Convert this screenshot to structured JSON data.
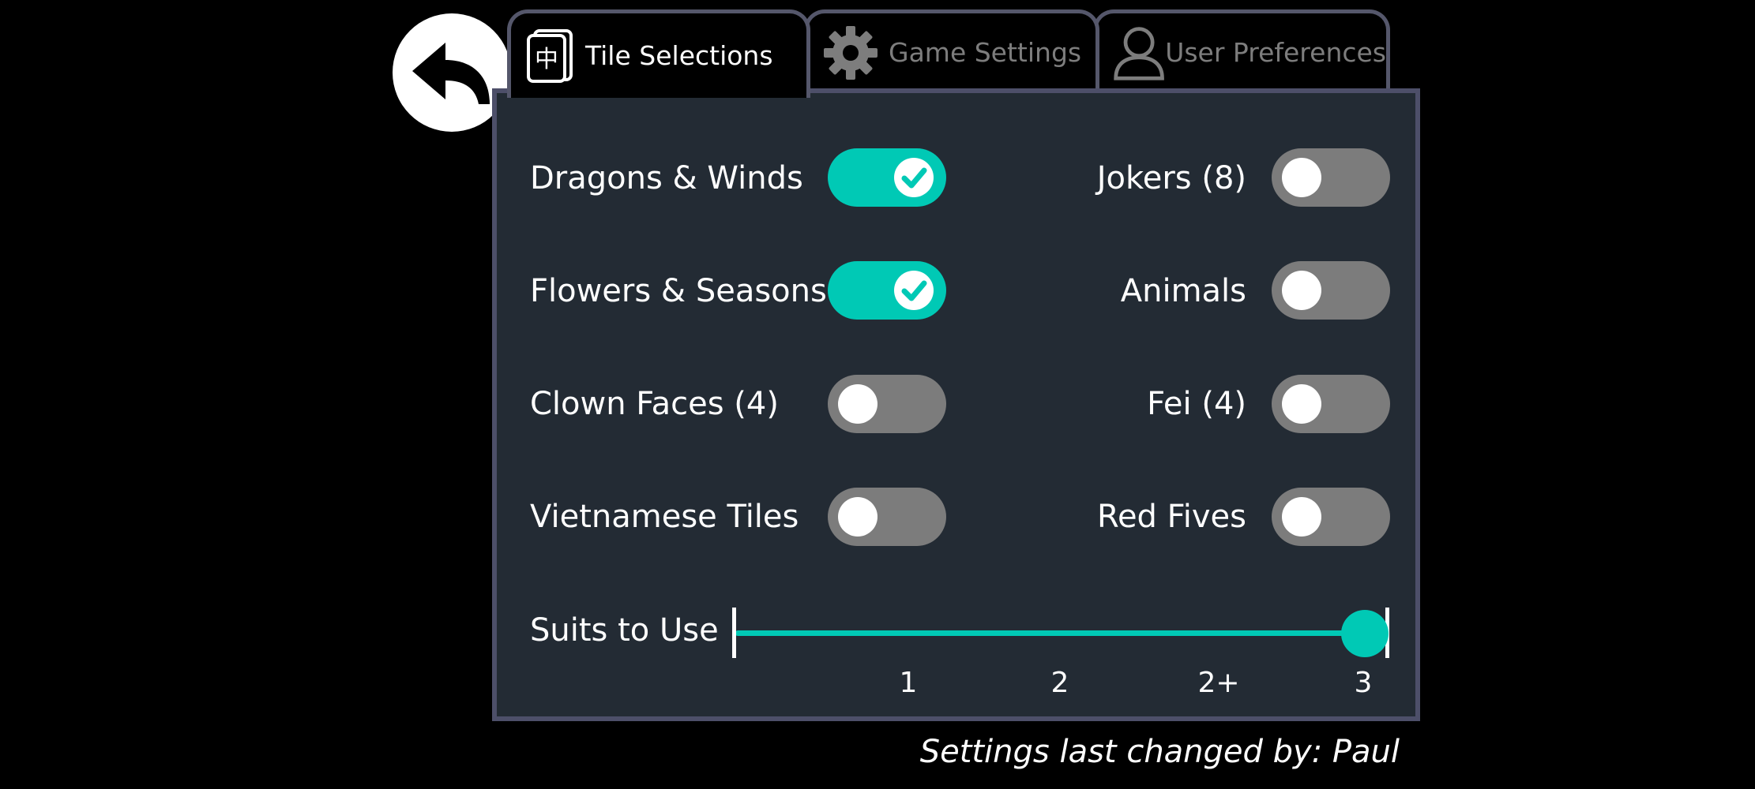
{
  "tabs": [
    {
      "label": "Tile Selections",
      "icon": "mahjong-tile-icon",
      "active": true
    },
    {
      "label": "Game Settings",
      "icon": "gear-icon",
      "active": false
    },
    {
      "label": "User Preferences",
      "icon": "user-icon",
      "active": false
    }
  ],
  "back_button": {
    "icon": "back-arrow-icon"
  },
  "tile_icon_glyph": "中",
  "options": {
    "dragons_winds": {
      "label": "Dragons & Winds",
      "enabled": true
    },
    "flowers_seasons": {
      "label": "Flowers & Seasons",
      "enabled": true
    },
    "clown_faces": {
      "label": "Clown Faces (4)",
      "enabled": false
    },
    "vietnamese_tiles": {
      "label": "Vietnamese Tiles",
      "enabled": false
    },
    "jokers": {
      "label": "Jokers (8)",
      "enabled": false
    },
    "animals": {
      "label": "Animals",
      "enabled": false
    },
    "fei": {
      "label": "Fei (4)",
      "enabled": false
    },
    "red_fives": {
      "label": "Red Fives",
      "enabled": false
    }
  },
  "suits_slider": {
    "label": "Suits to Use",
    "ticks": [
      "1",
      "2",
      "2+",
      "3"
    ],
    "selected": "3"
  },
  "footer": {
    "text": "Settings last changed by: Paul"
  },
  "colors": {
    "accent": "#00c9b5",
    "panel": "#232b34",
    "panel_border": "#4d4f69",
    "toggle_off": "#7c7c7c"
  }
}
